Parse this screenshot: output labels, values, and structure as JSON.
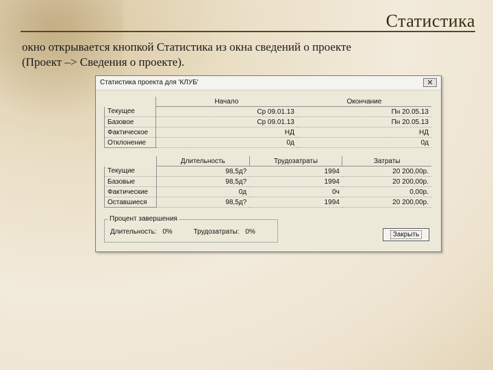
{
  "slide": {
    "title": "Статистика",
    "text_line1": "окно открывается кнопкой Статистика из окна сведений о проекте",
    "text_line2": "(Проект –> Сведения о проекте)."
  },
  "dialog": {
    "title": "Статистика проекта для 'КЛУБ'",
    "close_label": "✕",
    "dates_table": {
      "columns": [
        "",
        "Начало",
        "Окончание"
      ],
      "rows": [
        {
          "label": "Текущее",
          "start": "Ср 09.01.13",
          "end": "Пн 20.05.13"
        },
        {
          "label": "Базовое",
          "start": "Ср 09.01.13",
          "end": "Пн 20.05.13"
        },
        {
          "label": "Фактическое",
          "start": "НД",
          "end": "НД"
        },
        {
          "label": "Отклонение",
          "start": "0д",
          "end": "0д"
        }
      ]
    },
    "work_table": {
      "columns": [
        "",
        "Длительность",
        "Трудозатраты",
        "Затраты"
      ],
      "rows": [
        {
          "label": "Текущие",
          "duration": "98,5д?",
          "work": "1994",
          "cost": "20 200,00р."
        },
        {
          "label": "Базовые",
          "duration": "98,5д?",
          "work": "1994",
          "cost": "20 200,00р."
        },
        {
          "label": "Фактические",
          "duration": "0д",
          "work": "0ч",
          "cost": "0,00р."
        },
        {
          "label": "Оставшиеся",
          "duration": "98,5д?",
          "work": "1994",
          "cost": "20 200,00р."
        }
      ]
    },
    "percent_complete": {
      "legend": "Процент завершения",
      "duration_label": "Длительность:",
      "duration_value": "0%",
      "work_label": "Трудозатраты:",
      "work_value": "0%"
    },
    "close_button_label": "Закрыть"
  }
}
